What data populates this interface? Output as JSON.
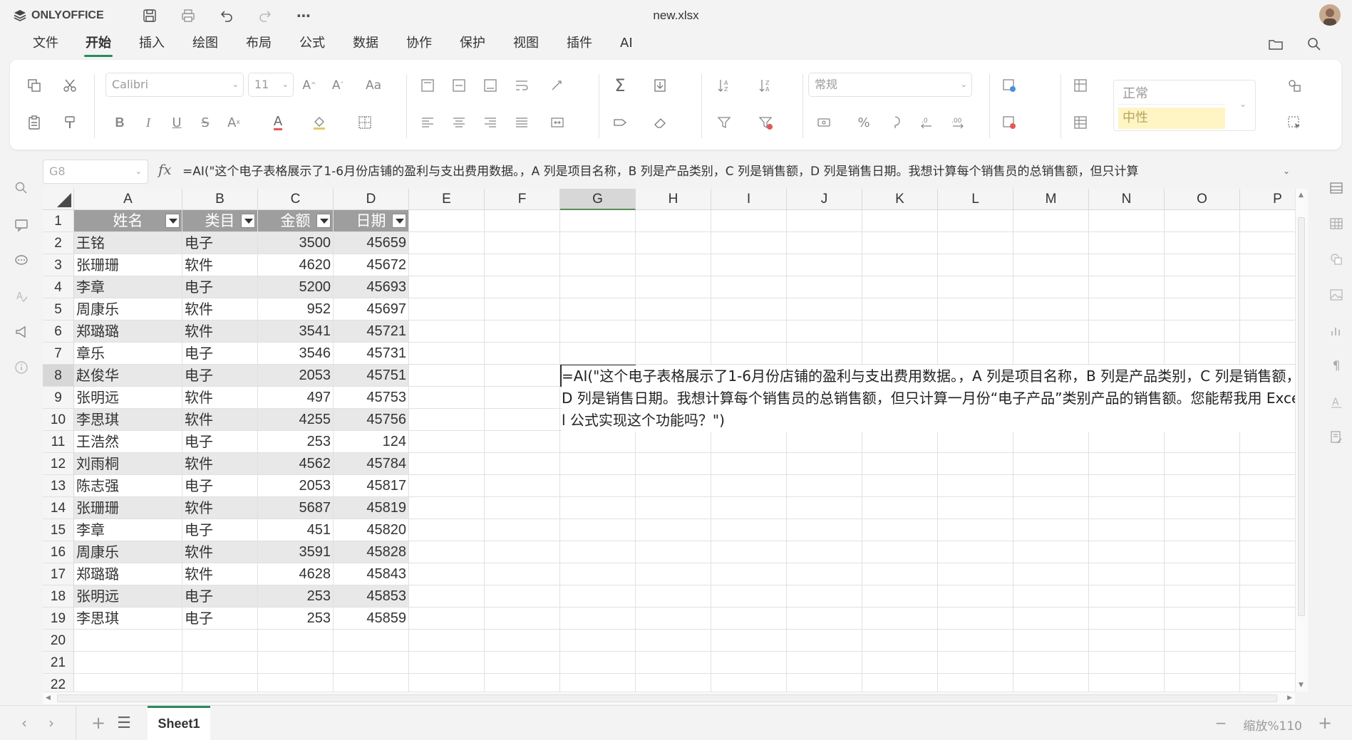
{
  "app": {
    "name": "ONLYOFFICE",
    "doc_title": "new.xlsx"
  },
  "menu": [
    "文件",
    "开始",
    "插入",
    "绘图",
    "布局",
    "公式",
    "数据",
    "协作",
    "保护",
    "视图",
    "插件",
    "AI"
  ],
  "menu_active": "开始",
  "ribbon": {
    "font_name": "Calibri",
    "font_size": "11",
    "number_format": "常规",
    "style_normal": "正常",
    "style_neutral": "中性"
  },
  "formula_bar": {
    "name_box": "G8",
    "fx": "fx",
    "formula": "=AI(\"这个电子表格展示了1-6月份店铺的盈利与支出费用数据。，A 列是项目名称，B 列是产品类别，C 列是销售额，D 列是销售日期。我想计算每个销售员的总销售额，但只计算"
  },
  "columns": [
    "A",
    "B",
    "C",
    "D",
    "E",
    "F",
    "G",
    "H",
    "I",
    "J",
    "K",
    "L",
    "M",
    "N",
    "O",
    "P"
  ],
  "selected_column": "G",
  "selected_row": "8",
  "table": {
    "headers": [
      "姓名",
      "类目",
      "金额",
      "日期"
    ],
    "rows": [
      [
        "王铭",
        "电子",
        "3500",
        "45659"
      ],
      [
        "张珊珊",
        "软件",
        "4620",
        "45672"
      ],
      [
        "李章",
        "电子",
        "5200",
        "45693"
      ],
      [
        "周康乐",
        "软件",
        "952",
        "45697"
      ],
      [
        "郑璐璐",
        "软件",
        "3541",
        "45721"
      ],
      [
        "章乐",
        "电子",
        "3546",
        "45731"
      ],
      [
        "赵俊华",
        "电子",
        "2053",
        "45751"
      ],
      [
        "张明远",
        "软件",
        "497",
        "45753"
      ],
      [
        " 李思琪",
        "软件",
        "4255",
        "45756"
      ],
      [
        "王浩然",
        "电子",
        "253",
        "124"
      ],
      [
        " 刘雨桐",
        "软件",
        "4562",
        "45784"
      ],
      [
        "陈志强",
        "电子",
        "2053",
        "45817"
      ],
      [
        "张珊珊",
        "软件",
        "5687",
        "45819"
      ],
      [
        "李章",
        "电子",
        "451",
        "45820"
      ],
      [
        "周康乐",
        "软件",
        "3591",
        "45828"
      ],
      [
        "郑璐璐",
        "软件",
        "4628",
        "45843"
      ],
      [
        "张明远",
        "电子",
        "253",
        "45853"
      ],
      [
        " 李思琪",
        "电子",
        "253",
        "45859"
      ]
    ]
  },
  "row_numbers": [
    "1",
    "2",
    "3",
    "4",
    "5",
    "6",
    "7",
    "8",
    "9",
    "10",
    "11",
    "12",
    "13",
    "14",
    "15",
    "16",
    "17",
    "18",
    "19",
    "20",
    "21",
    "22"
  ],
  "g8_content": "=AI(\"这个电子表格展示了1-6月份店铺的盈利与支出费用数据。，A 列是项目名称，B 列是产品类别，C 列是销售额，D 列是销售日期。我想计算每个销售员的总销售额，但只计算一月份“电子产品”类别产品的销售额。您能帮我用 Excel 公式实现这个功能吗？\")",
  "sheet_tab": "Sheet1",
  "zoom": "缩放%110",
  "colors": {
    "accent": "#2a8a5f",
    "header_fill": "#9e9e9e",
    "band_fill": "#e8e8e8"
  }
}
